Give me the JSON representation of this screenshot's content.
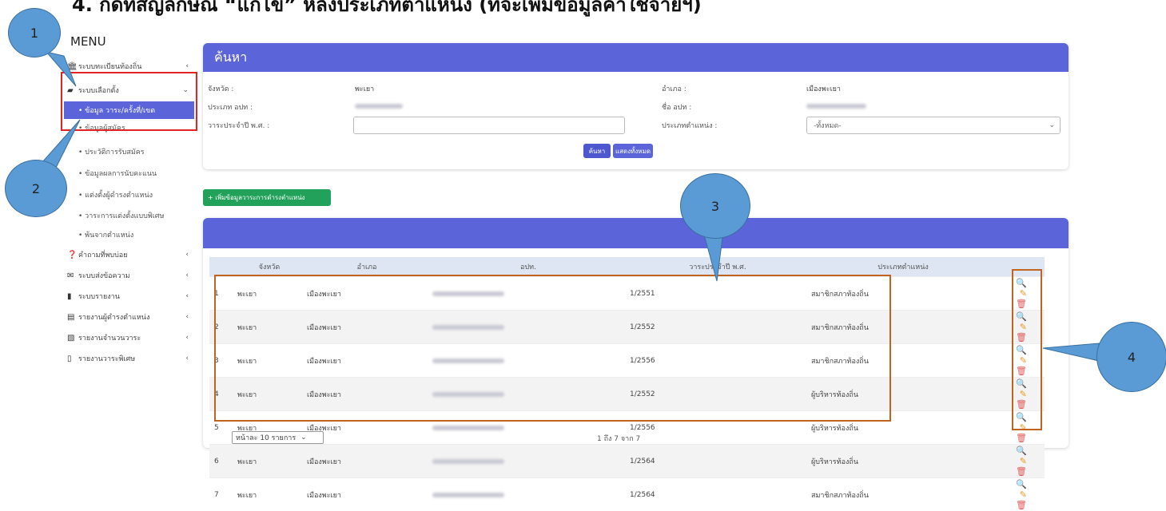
{
  "heading": "4.   กดที่สัญลักษณ์ “แก้ไข” หลังประเภทตำแหน่ง (ที่จะเพิ่มข้อมูลค่าใช้จ่ายฯ)",
  "sidebar": {
    "title": "MENU",
    "items": [
      {
        "label": "ระบบทะเบียนท้องถิ่น",
        "icon": "bank-icon",
        "arrow": "‹"
      },
      {
        "label": "ระบบเลือกตั้ง",
        "icon": "vote-icon",
        "arrow": "⌄"
      },
      {
        "label": "คำถามที่พบบ่อย",
        "icon": "question-icon",
        "arrow": "‹"
      },
      {
        "label": "ระบบส่งข้อความ",
        "icon": "mail-icon",
        "arrow": "‹"
      },
      {
        "label": "ระบบรายงาน",
        "icon": "file-icon",
        "arrow": "‹"
      },
      {
        "label": "รายงานผู้ดำรงตำแหน่ง",
        "icon": "report-icon",
        "arrow": "‹"
      },
      {
        "label": "รายงานจำนวนวาระ",
        "icon": "report-user-icon",
        "arrow": "‹"
      },
      {
        "label": "รายงานวาระพิเศษ",
        "icon": "file-text-icon",
        "arrow": "‹"
      }
    ],
    "active_sub": "• ข้อมูล วาระ/ครั้งที่/เขต",
    "subs": [
      "• ข้อมูลผู้สมัคร",
      "• ประวัติการรับสมัคร",
      "• ข้อมูลผลการนับคะแนน",
      "• แต่งตั้งผู้ดำรงตำแหน่ง",
      "• วาระการแต่งตั้งแบบพิเศษ",
      "• พ้นจากตำแหน่ง"
    ]
  },
  "search": {
    "title": "ค้นหา",
    "province_label": "จังหวัด :",
    "province_value": "พะเยา",
    "district_label": "อำเภอ :",
    "district_value": "เมืองพะเยา",
    "org_type_label": "ประเภท อปท :",
    "org_name_label": "ชื่อ อปท :",
    "term_label": "วาระประจำปี พ.ศ. :",
    "term_value": "",
    "position_type_label": "ประเภทตำแหน่ง :",
    "position_type_value": "-ทั้งหมด-",
    "search_btn": "ค้นหา",
    "show_all_btn": "แสดงทั้งหมด"
  },
  "add_button": "+ เพิ่มข้อมูลวาระการดำรงตำแหน่ง",
  "table": {
    "headers": [
      "",
      "จังหวัด",
      "อำเภอ",
      "อปท.",
      "วาระประจำปี พ.ศ.",
      "ประเภทตำแหน่ง",
      ""
    ],
    "rows": [
      {
        "no": "1",
        "province": "พะเยา",
        "district": "เมืองพะเยา",
        "term": "1/2551",
        "type": "สมาชิกสภาท้องถิ่น"
      },
      {
        "no": "2",
        "province": "พะเยา",
        "district": "เมืองพะเยา",
        "term": "1/2552",
        "type": "สมาชิกสภาท้องถิ่น"
      },
      {
        "no": "3",
        "province": "พะเยา",
        "district": "เมืองพะเยา",
        "term": "1/2556",
        "type": "สมาชิกสภาท้องถิ่น"
      },
      {
        "no": "4",
        "province": "พะเยา",
        "district": "เมืองพะเยา",
        "term": "1/2552",
        "type": "ผู้บริหารท้องถิ่น"
      },
      {
        "no": "5",
        "province": "พะเยา",
        "district": "เมืองพะเยา",
        "term": "1/2556",
        "type": "ผู้บริหารท้องถิ่น"
      },
      {
        "no": "6",
        "province": "พะเยา",
        "district": "เมืองพะเยา",
        "term": "1/2564",
        "type": "ผู้บริหารท้องถิ่น"
      },
      {
        "no": "7",
        "province": "พะเยา",
        "district": "เมืองพะเยา",
        "term": "1/2564",
        "type": "สมาชิกสภาท้องถิ่น"
      }
    ]
  },
  "pager": {
    "page_size": "หน้าละ 10 รายการ",
    "info": "1 ถึง 7 จาก 7"
  },
  "callouts": [
    "1",
    "2",
    "3",
    "4"
  ],
  "colors": {
    "accent": "#5b64d8",
    "add_green": "#21a15a",
    "callout": "#5b9bd5",
    "highlight_red": "#e02424",
    "highlight_orange": "#c0651f"
  }
}
